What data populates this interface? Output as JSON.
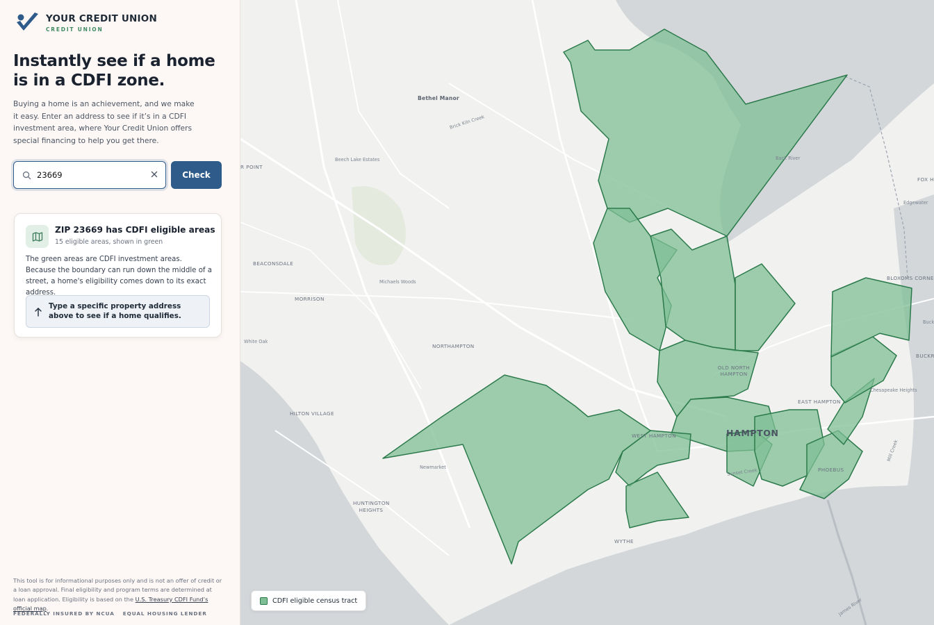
{
  "brand": {
    "name": "YOUR CREDIT UNION",
    "subtitle": "CREDIT UNION"
  },
  "hero": {
    "headline": "Instantly see if a home is in a CDFI zone.",
    "intro": "Buying a home is an achievement, and we make it easy. Enter an address to see if it’s in a CDFI investment area, where Your Credit Union offers special financing to help you get there."
  },
  "search": {
    "value": "23669",
    "placeholder": "",
    "check_label": "Check"
  },
  "result": {
    "title": "ZIP 23669 has CDFI eligible areas",
    "subtitle": "15 eligible areas, shown in green",
    "body": "The green areas are CDFI investment areas. Because the boundary can run down the middle of a street, a home's eligibility comes down to its exact address.",
    "hint": "Type a specific property address above to see if a home qualifies."
  },
  "disclaimer": {
    "text": "This tool is for informational purposes only and is not an offer of credit or a loan approval. Final eligibility and program terms are determined at loan application. Eligibility is based on the ",
    "link": "U.S. Treasury CDFI Fund’s official map",
    "end": "."
  },
  "footer": {
    "ncua": "FEDERALLY INSURED BY NCUA",
    "housing": "EQUAL HOUSING LENDER"
  },
  "map": {
    "places": {
      "bethel_manor": "Bethel Manor",
      "brick_kiln_creek": "Brick Kiln Creek",
      "beech_lake_estates": "Beech Lake Estates",
      "r_point": "R POINT",
      "beaconsdale": "BEACONSDALE",
      "michaels_woods": "Michaels Woods",
      "morrison": "MORRISON",
      "white_oak": "White Oak",
      "northampton": "NORTHAMPTON",
      "hilton_village": "HILTON VILLAGE",
      "newmarket": "Newmarket",
      "huntington_heights": "HUNTINGTON HEIGHTS",
      "wythe": "WYTHE",
      "west_hampton": "WEST HAMPTON",
      "hampton": "HAMPTON",
      "old_north_hampton": "OLD NORTH HAMPTON",
      "east_hampton": "EAST HAMPTON",
      "phoebus": "PHOEBUS",
      "fox_hill": "FOX H",
      "edgewater": "Edgewater",
      "bloxoms_corner": "BLOXOMS CORNE",
      "buckroe": "BUCKR",
      "back_river": "Back River",
      "chesapeake_heights": "Chesapeake Heights",
      "sunset_creek": "Sunset Creek",
      "mill_creek": "Mill Creek",
      "james_river": "James River",
      "buck": "Buck"
    },
    "legend": "CDFI eligible census tract",
    "colors": {
      "tract_fill": "#7fbf95",
      "tract_stroke": "#2c7a4b",
      "water": "#d3d7da",
      "land": "#f1f1ef",
      "road": "#ffffff"
    }
  }
}
